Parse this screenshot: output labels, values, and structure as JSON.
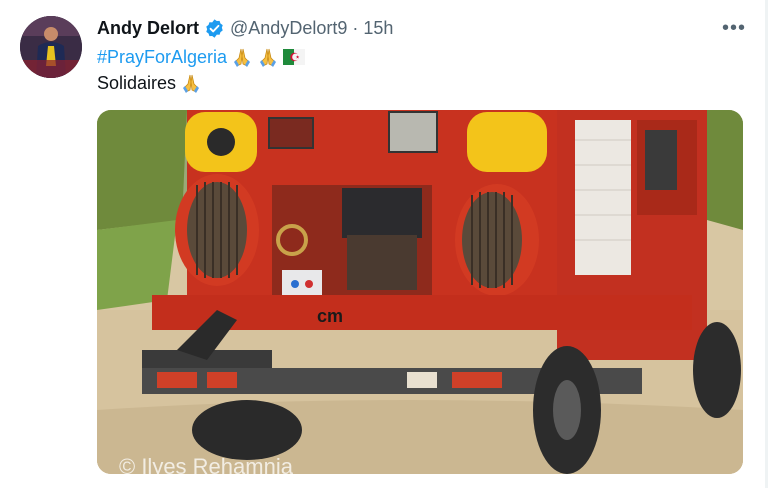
{
  "tweet": {
    "author_name": "Andy Delort",
    "handle": "@AndyDelort9",
    "separator": "·",
    "time": "15h",
    "more_label": "•••",
    "hashtag": "#PrayForAlgeria",
    "text_line2": "Solidaires",
    "emojis": [
      "folded-hands",
      "folded-hands",
      "flag-algeria",
      "folded-hands"
    ]
  },
  "media": {
    "watermark": "© Ilyes Rehamnia",
    "vehicle_text": "cm",
    "colors": {
      "truck_red": "#c8321f",
      "hose_reel": "#d23a22",
      "light_yellow": "#f3c41a",
      "ground": "#d8c7a3",
      "grass": "#7fa34a"
    }
  },
  "colors": {
    "link": "#1d9bf0",
    "secondary_text": "#536471",
    "primary_text": "#0f1419"
  }
}
